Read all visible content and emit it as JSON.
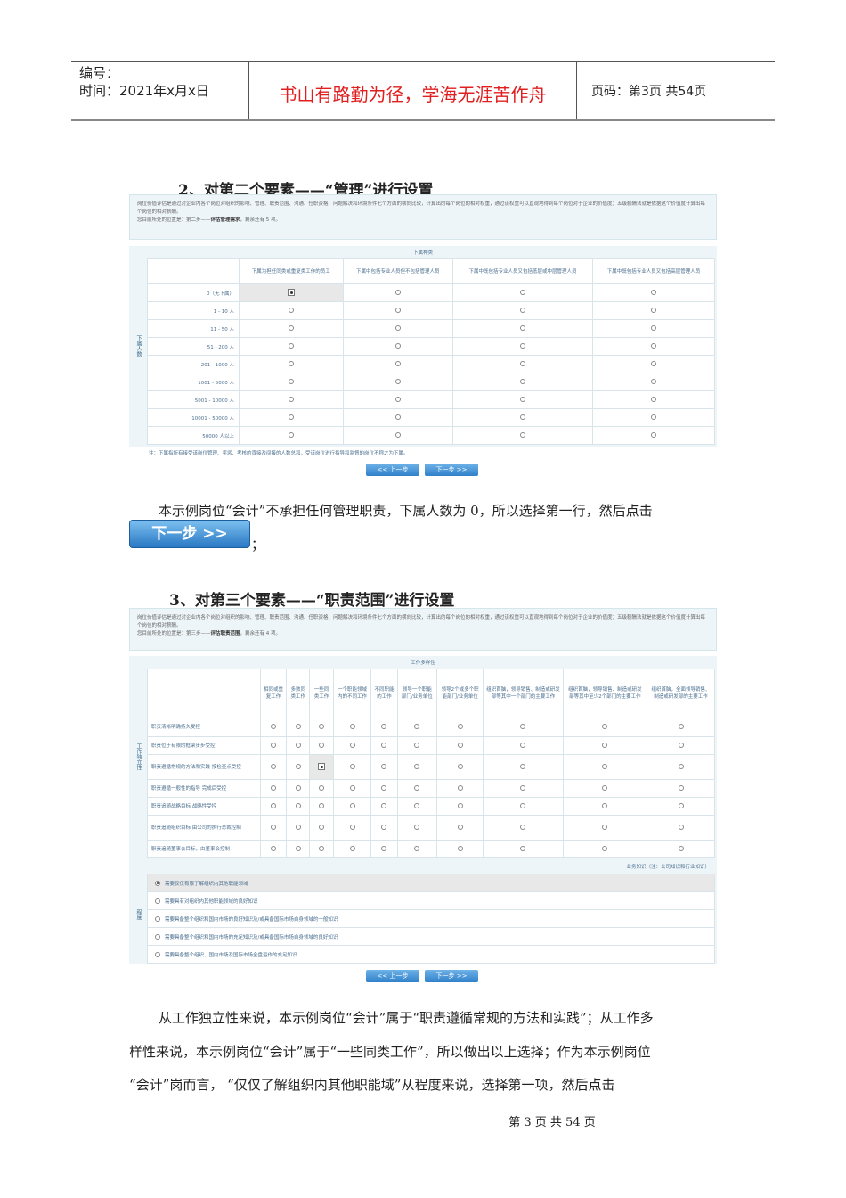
{
  "header": {
    "code_label": "编号：",
    "time_label": "时间：2021年x月x日",
    "motto": "书山有路勤为径，学海无涯苦作舟",
    "page_info": "页码：第3页 共54页"
  },
  "section2": {
    "heading": "2、对第二个要素——“管理”进行设置",
    "info": {
      "line1": "岗位价值评估是通过对企业内各个岗位对组织的影响、管理、职责范围、沟通、任职资格、问题解决和环境条件七个方面的横向比较，计算出的每个岗位的相对权重，通过该权重可以直观地得到每个岗位对于企业的价值度；五级薪酬法就是依据这个价值度计算出每个岗位的相对薪酬。",
      "pos_prefix": "您目前所处的位置是：第二步——",
      "pos_step": "评估管理需求",
      "pos_suffix": "，剩余还有 5 项。"
    },
    "group_header": "下属种类",
    "row_axis_label": "下属人数",
    "columns": [
      "下属为担任同类或重复类工作的员工",
      "下属中包括专业人员但不包括管理人员",
      "下属中既包括专业人员又包括低层或中层管理人员",
      "下属中既包括专业人员又包括高层管理人员"
    ],
    "rows": [
      "0（无下属）",
      "1 - 10 人",
      "11 - 50 人",
      "51 - 200 人",
      "201 - 1000 人",
      "1001 - 5000 人",
      "5001 - 10000 人",
      "10001 - 50000 人",
      "50000 人以上"
    ],
    "selected": {
      "row": 0,
      "col": 0
    },
    "note": "注：下属指所有接受该岗位管理、奖惩、考核的直接及间接的人数总和，受该岗位进行指导和监督的岗位不称之为下属。",
    "prev": "<< 上一步",
    "next": "下一步 >>"
  },
  "para1": "本示例岗位“会计”不承担任何管理职责，下属人数为 0，所以选择第一行，然后点击",
  "big_next": "下一步 >>",
  "para1_end": "；",
  "section3": {
    "heading": "3、对第三个要素——“职责范围”进行设置",
    "info": {
      "line1": "岗位价值评估是通过对企业内各个岗位对组织的影响、管理、职责范围、沟通、任职资格、问题解决和环境条件七个方面的横向比较，计算出的每个岗位的相对权重，通过该权重可以直观地得到每个岗位对于企业的价值度；五级薪酬法就是依据这个价值度计算出每个岗位的相对薪酬。",
      "pos_prefix": "您目前所处的位置是：第三步——",
      "pos_step": "评估职责范围",
      "pos_suffix": "，剩余还有 4 项。"
    },
    "group_header": "工作多样性",
    "row_axis_label": "工作独立性",
    "columns": [
      "相同或重复工作",
      "多数同类工作",
      "一些同类工作",
      "一个职能领域内的不同工作",
      "不同职能的工作",
      "领导一个职能部门/业务单位",
      "领导2个或多个职能部门/业务单位",
      "组织首脑，领导销售、制造或研发部等其中一个部门的主要工作",
      "组织首脑，领导销售、制造或研发部等其中至少2个部门的主要工作",
      "组织首脑，全面领导销售、制造或研发部的主要工作"
    ],
    "rows": [
      "职责清晰明确持久受控",
      "职责位于有限的框架步步受控",
      "职责遵循常规的方法和实践 按检查点受控",
      "职责遵循一般性的指导 完成后受控",
      "职责追随战略目标 战略性受控",
      "职责追随组织目标 由公司的执行总裁控制",
      "职责追随董事会目标，由董事会控制"
    ],
    "selected": {
      "row": 2,
      "col": 2
    },
    "knowledge_header": "业务知识（注：公司知识和行业知识）",
    "knowledge_axis_label": "程度",
    "knowledge_options": [
      "需要仅仅有限了解组织内其他职能领域",
      "需要具有对组织内其他职能领域的良好知识",
      "需要具备整个组织和国内市场的良好知识及/或具备国际市场自身领域的一般知识",
      "需要具备整个组织和国内市场的充足知识及/或具备国际市场自身领域的良好知识",
      "需要具备整个组织、国内市场及国际市场全盘运作的充足知识"
    ],
    "knowledge_selected": 0,
    "prev": "<< 上一步",
    "next": "下一步 >>"
  },
  "para2": [
    "从工作独立性来说，本示例岗位“会计”属于“职责遵循常规的方法和实践”；从工作多",
    "样性来说，本示例岗位“会计”属于“一些同类工作”，所以做出以上选择；作为本示例岗位",
    "“会计”岗而言，  “仅仅了解组织内其他职能域”从程度来说，选择第一项，然后点击"
  ],
  "footer": "第 3 页 共 54 页"
}
